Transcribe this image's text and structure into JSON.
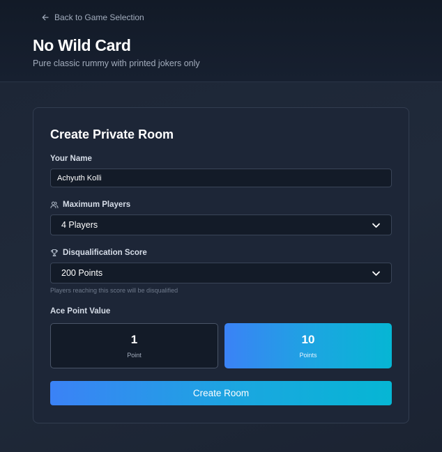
{
  "header": {
    "back_label": "Back to Game Selection",
    "title": "No Wild Card",
    "subtitle": "Pure classic rummy with printed jokers only"
  },
  "form": {
    "title": "Create Private Room",
    "name": {
      "label": "Your Name",
      "value": "Achyuth Kolli"
    },
    "max_players": {
      "label": "Maximum Players",
      "icon": "users-icon",
      "selected": "4 Players"
    },
    "disqualification": {
      "label": "Disqualification Score",
      "icon": "trophy-icon",
      "selected": "200 Points",
      "hint": "Players reaching this score will be disqualified"
    },
    "ace": {
      "label": "Ace Point Value",
      "options": [
        {
          "value": "1",
          "unit": "Point",
          "selected": false
        },
        {
          "value": "10",
          "unit": "Points",
          "selected": true
        }
      ]
    },
    "submit_label": "Create Room"
  },
  "colors": {
    "accent_start": "#3b82f6",
    "accent_end": "#06b6d4",
    "background": "#1c2535",
    "card": "#1d2637"
  }
}
